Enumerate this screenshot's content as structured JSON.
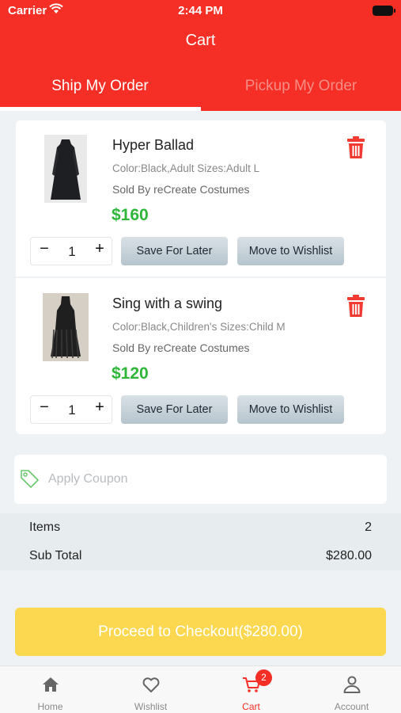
{
  "status_bar": {
    "carrier": "Carrier",
    "time": "2:44 PM"
  },
  "header": {
    "title": "Cart"
  },
  "tabs": [
    {
      "label": "Ship My Order",
      "active": true
    },
    {
      "label": "Pickup My Order",
      "active": false
    }
  ],
  "cart_items": [
    {
      "name": "Hyper Ballad",
      "attributes": "Color:Black,Adult Sizes:Adult L",
      "seller": "Sold By reCreate Costumes",
      "price": "$160",
      "quantity": "1",
      "minus": "−",
      "plus": "+",
      "save_label": "Save For Later",
      "move_label": "Move to Wishlist"
    },
    {
      "name": "Sing with a swing",
      "attributes": "Color:Black,Children's Sizes:Child M",
      "seller": "Sold By reCreate Costumes",
      "price": "$120",
      "quantity": "1",
      "minus": "−",
      "plus": "+",
      "save_label": "Save For Later",
      "move_label": "Move to Wishlist"
    }
  ],
  "coupon": {
    "placeholder": "Apply Coupon"
  },
  "summary": {
    "items_label": "Items",
    "items_value": "2",
    "subtotal_label": "Sub Total",
    "subtotal_value": "$280.00"
  },
  "checkout": {
    "label": "Proceed to Checkout($280.00)"
  },
  "tabbar": {
    "home": "Home",
    "wishlist": "Wishlist",
    "cart": "Cart",
    "cart_badge": "2",
    "account": "Account"
  },
  "colors": {
    "brand_red": "#f52f25",
    "price_green": "#2eb638",
    "checkout_yellow": "#fcd850"
  }
}
